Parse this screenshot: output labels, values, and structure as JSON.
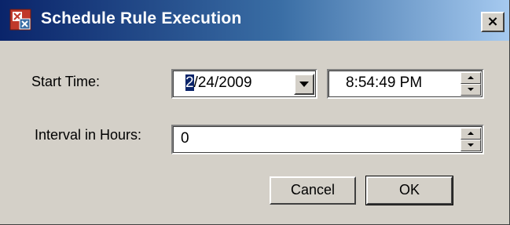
{
  "dialog": {
    "title": "Schedule Rule Execution",
    "close_glyph": "×",
    "icon": "app-icon"
  },
  "start_time": {
    "label": "Start Time:",
    "date_selected_part": "2",
    "date_rest": "/24/2009",
    "time": "8:54:49 PM"
  },
  "interval": {
    "label": "Interval in Hours:",
    "value": "0"
  },
  "buttons": {
    "cancel": "Cancel",
    "ok": "OK"
  },
  "colors": {
    "title_gradient_start": "#0a246a",
    "title_gradient_end": "#a6caf0",
    "face": "#d4d0c8",
    "selection": "#0a246a"
  }
}
